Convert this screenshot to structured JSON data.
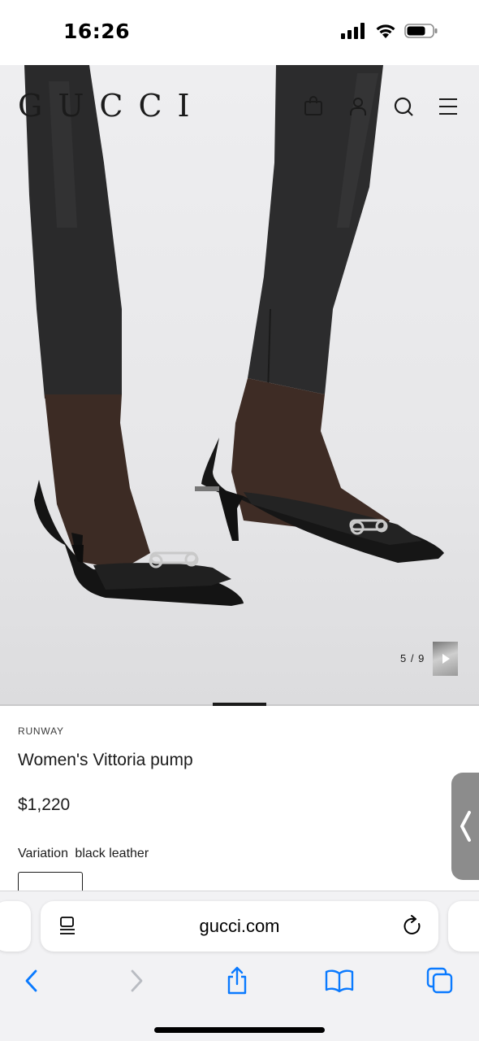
{
  "status_bar": {
    "time": "16:26"
  },
  "site": {
    "logo": "GUCCI"
  },
  "header_icons": [
    "shopping-bag-icon",
    "account-icon",
    "search-icon",
    "menu-icon"
  ],
  "gallery": {
    "counter": "5 / 9",
    "current": 5,
    "total": 9
  },
  "product": {
    "collection": "RUNWAY",
    "name": "Women's Vittoria pump",
    "price": "$1,220",
    "variation_label": "Variation",
    "variation_value": "black leather"
  },
  "browser": {
    "url": "gucci.com",
    "toolbar": [
      "back-icon",
      "forward-icon",
      "share-icon",
      "bookmarks-icon",
      "tabs-icon"
    ]
  },
  "colors": {
    "accent_ios": "#0a7aff",
    "disabled_ios": "#b9bcc2",
    "text": "#1b1b1b"
  }
}
